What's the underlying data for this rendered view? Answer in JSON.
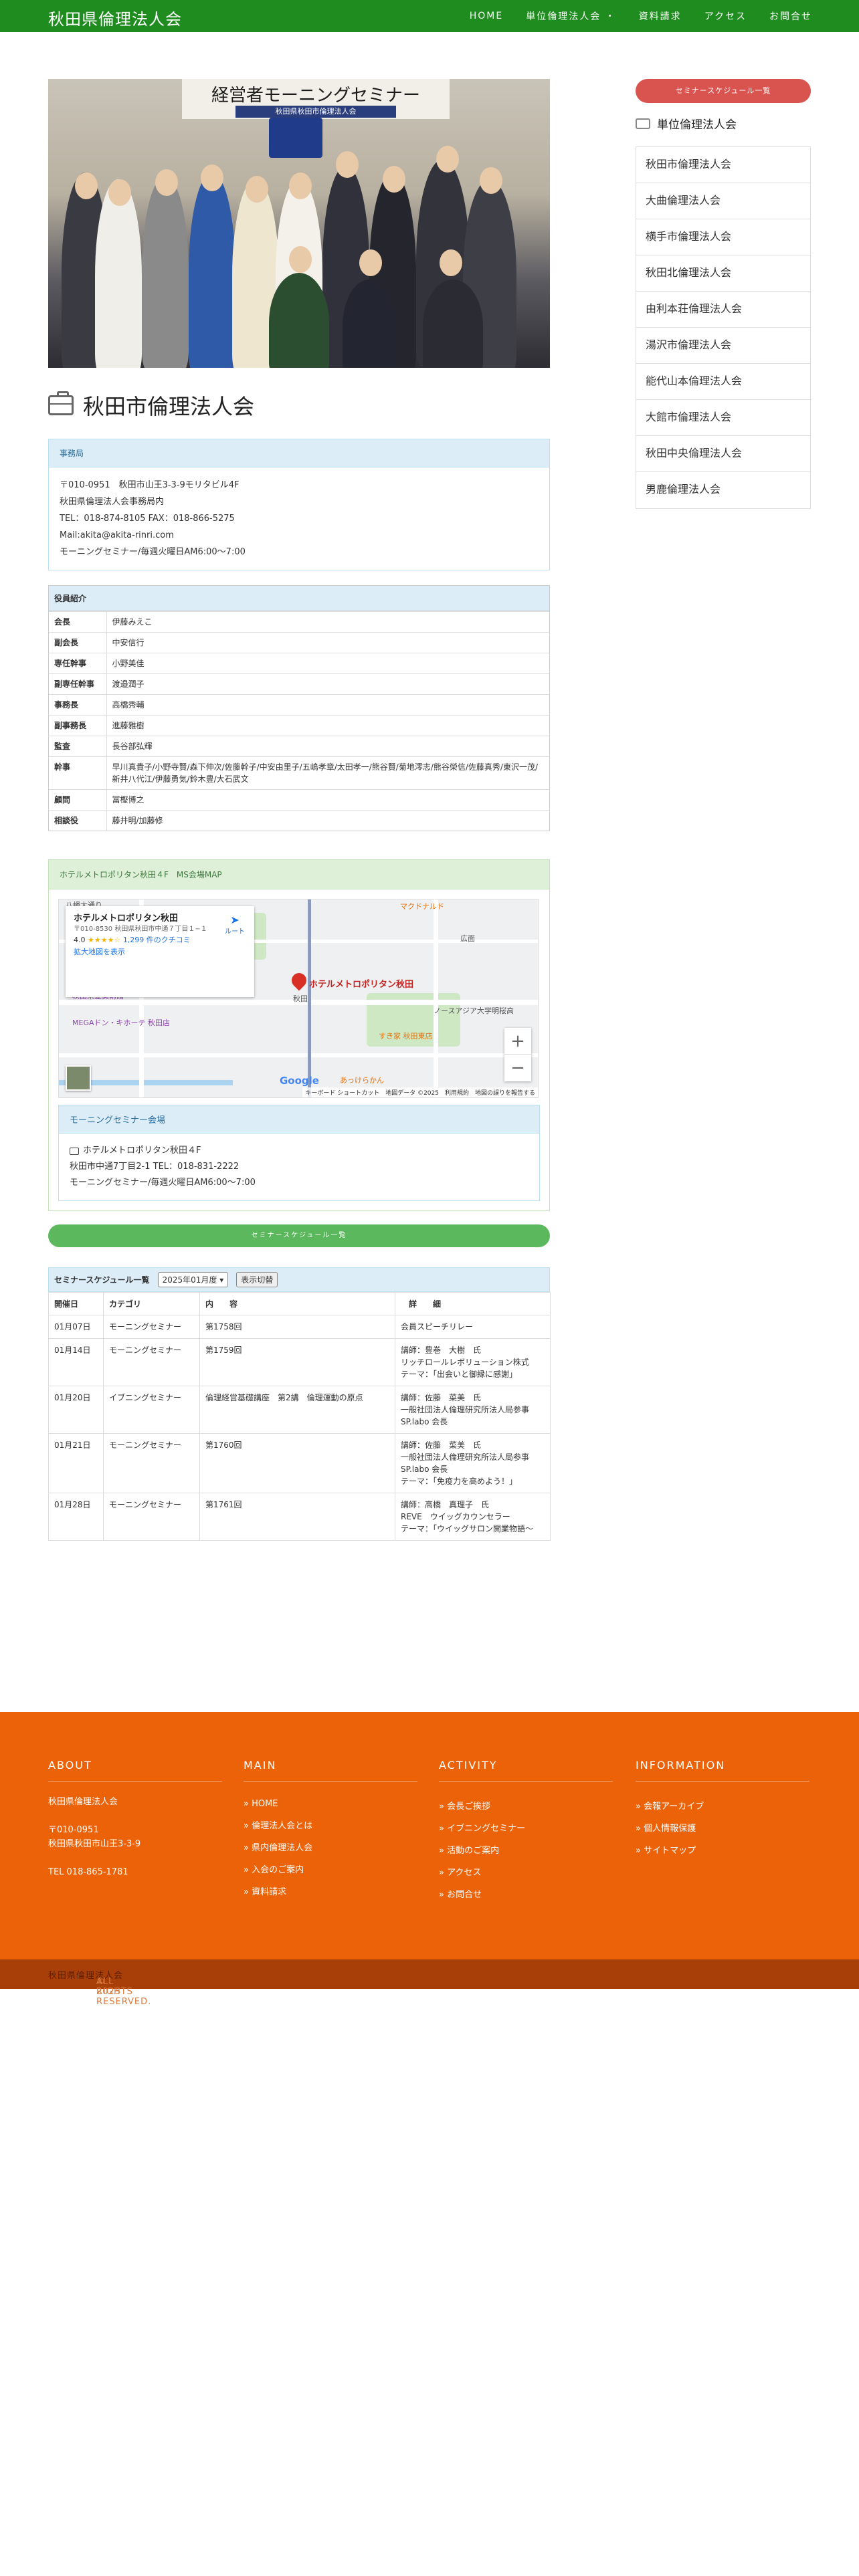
{
  "header": {
    "site_title": "秋田県倫理法人会",
    "nav": [
      "HOME",
      "単位倫理法人会 ・",
      "資料請求",
      "アクセス",
      "お問合せ"
    ]
  },
  "hero": {
    "banner_title": "経営者モーニングセミナー",
    "banner_sub": "秋田県秋田市倫理法人会"
  },
  "page": {
    "title": "秋田市倫理法人会"
  },
  "office": {
    "heading": "事務局",
    "lines": [
      "〒010-0951　秋田市山王3-3-9モリタビル4F",
      "秋田県倫理法人会事務局内",
      "TEL：018-874-8105 FAX：018-866-5275",
      "Mail:akita@akita-rinri.com",
      "モーニングセミナー/毎週火曜日AM6:00〜7:00"
    ]
  },
  "officers": {
    "heading": "役員紹介",
    "rows": [
      {
        "role": "会長",
        "name": "伊藤みえこ"
      },
      {
        "role": "副会長",
        "name": "中安信行"
      },
      {
        "role": "専任幹事",
        "name": "小野美佳"
      },
      {
        "role": "副専任幹事",
        "name": "渡邉潤子"
      },
      {
        "role": "事務長",
        "name": "高橋秀輔"
      },
      {
        "role": "副事務長",
        "name": "進藤雅樹"
      },
      {
        "role": "監査",
        "name": "長谷部弘輝"
      },
      {
        "role": "幹事",
        "name": "早川真貴子/小野寺賢/森下伸次/佐藤幹子/中安由里子/五嶋孝章/太田孝一/熊谷賢/菊地澪志/熊谷榮信/佐藤真秀/東沢一茂/新井八代江/伊藤勇気/鈴木豊/大石武文"
      },
      {
        "role": "顧問",
        "name": "冨樫博之"
      },
      {
        "role": "相談役",
        "name": "藤井明/加藤修"
      }
    ]
  },
  "map_panel": {
    "heading": "ホテルメトロポリタン秋田４F　MS会場MAP",
    "card_title": "ホテルメトロポリタン秋田",
    "card_addr": "〒010-8530 秋田県秋田市中通７丁目１−１",
    "card_route": "ルート",
    "card_rating": "4.0",
    "card_stars": "★★★★☆",
    "card_reviews": "1,299 件のクチコミ",
    "card_link": "拡大地図を表示",
    "pin_label": "ホテルメトロポリタン秋田",
    "labels": [
      "マクドナルド",
      "広面",
      "秋田県立美術館",
      "秋田",
      "ノースアジア大学明桜高",
      "MEGAドン・キホーテ 秋田店",
      "すき家 秋田東店",
      "あっけらかん",
      "八幡大通り"
    ],
    "zoom_in": "+",
    "zoom_out": "−",
    "google": "Google",
    "footer_text": "キーボード ショートカット　地図データ ©2025　利用規約　地図の誤りを報告する"
  },
  "venue": {
    "heading": "モーニングセミナー会場",
    "name": "ホテルメトロポリタン秋田４F",
    "addr": "秋田市中通7丁目2-1 TEL：018-831-2222",
    "time": "モーニングセミナー/毎週火曜日AM6:00〜7:00"
  },
  "schedule_button": "セミナースケジュール一覧",
  "schedule": {
    "heading": "セミナースケジュール一覧",
    "month": "2025年01月度",
    "switch_btn": "表示切替",
    "columns": [
      "開催日",
      "カテゴリ",
      "内　　容",
      "　詳　　細"
    ],
    "rows": [
      {
        "date": "01月07日",
        "cat": "モーニングセミナー",
        "content": "第1758回",
        "detail": [
          "会員スピーチリレー"
        ]
      },
      {
        "date": "01月14日",
        "cat": "モーニングセミナー",
        "content": "第1759回",
        "detail": [
          "講師：豊巻　大樹　氏",
          "リッチロールレボリューション株式",
          "テーマ：「出会いと御縁に感謝」"
        ]
      },
      {
        "date": "01月20日",
        "cat": "イブニングセミナー",
        "content": "倫理経営基礎講座　第2講　倫理運動の原点",
        "detail": [
          "講師：佐藤　菜美　氏",
          "一般社団法人倫理研究所法人局参事",
          "SP.labo 会長"
        ]
      },
      {
        "date": "01月21日",
        "cat": "モーニングセミナー",
        "content": "第1760回",
        "detail": [
          "講師：佐藤　菜美　氏",
          "一般社団法人倫理研究所法人局参事",
          "SP.labo 会長",
          "テーマ：「免疫力を高めよう！」"
        ]
      },
      {
        "date": "01月28日",
        "cat": "モーニングセミナー",
        "content": "第1761回",
        "detail": [
          "講師：高橋　真理子　氏",
          "REVE　ウイッグカウンセラー",
          "テーマ：「ウイッグサロン開業物語〜"
        ]
      }
    ]
  },
  "sidebar": {
    "button": "セミナースケジュール一覧",
    "heading": "単位倫理法人会",
    "items": [
      "秋田市倫理法人会",
      "大曲倫理法人会",
      "横手市倫理法人会",
      "秋田北倫理法人会",
      "由利本荘倫理法人会",
      "湯沢市倫理法人会",
      "能代山本倫理法人会",
      "大館市倫理法人会",
      "秋田中央倫理法人会",
      "男鹿倫理法人会"
    ]
  },
  "footer": {
    "about": {
      "heading": "ABOUT",
      "name": "秋田県倫理法人会",
      "zip": "〒010-0951",
      "addr": "秋田県秋田市山王3-3-9",
      "tel": "TEL 018-865-1781"
    },
    "main": {
      "heading": "MAIN",
      "links": [
        "» HOME",
        "» 倫理法人会とは",
        "» 県内倫理法人会",
        "» 入会のご案内",
        "» 資料請求"
      ]
    },
    "activity": {
      "heading": "ACTIVITY",
      "links": [
        "» 会長ご挨拶",
        "» イブニングセミナー",
        "» 活動のご案内",
        "» アクセス",
        "» お問合せ"
      ]
    },
    "information": {
      "heading": "INFORMATION",
      "links": [
        "» 会報アーカイブ",
        "» 個人情報保護",
        "» サイトマップ"
      ]
    },
    "copyright_pre": "© 2025 ",
    "copyright_name": "秋田県倫理法人会",
    "copyright_post": " ALL RIGHTS RESERVED."
  }
}
